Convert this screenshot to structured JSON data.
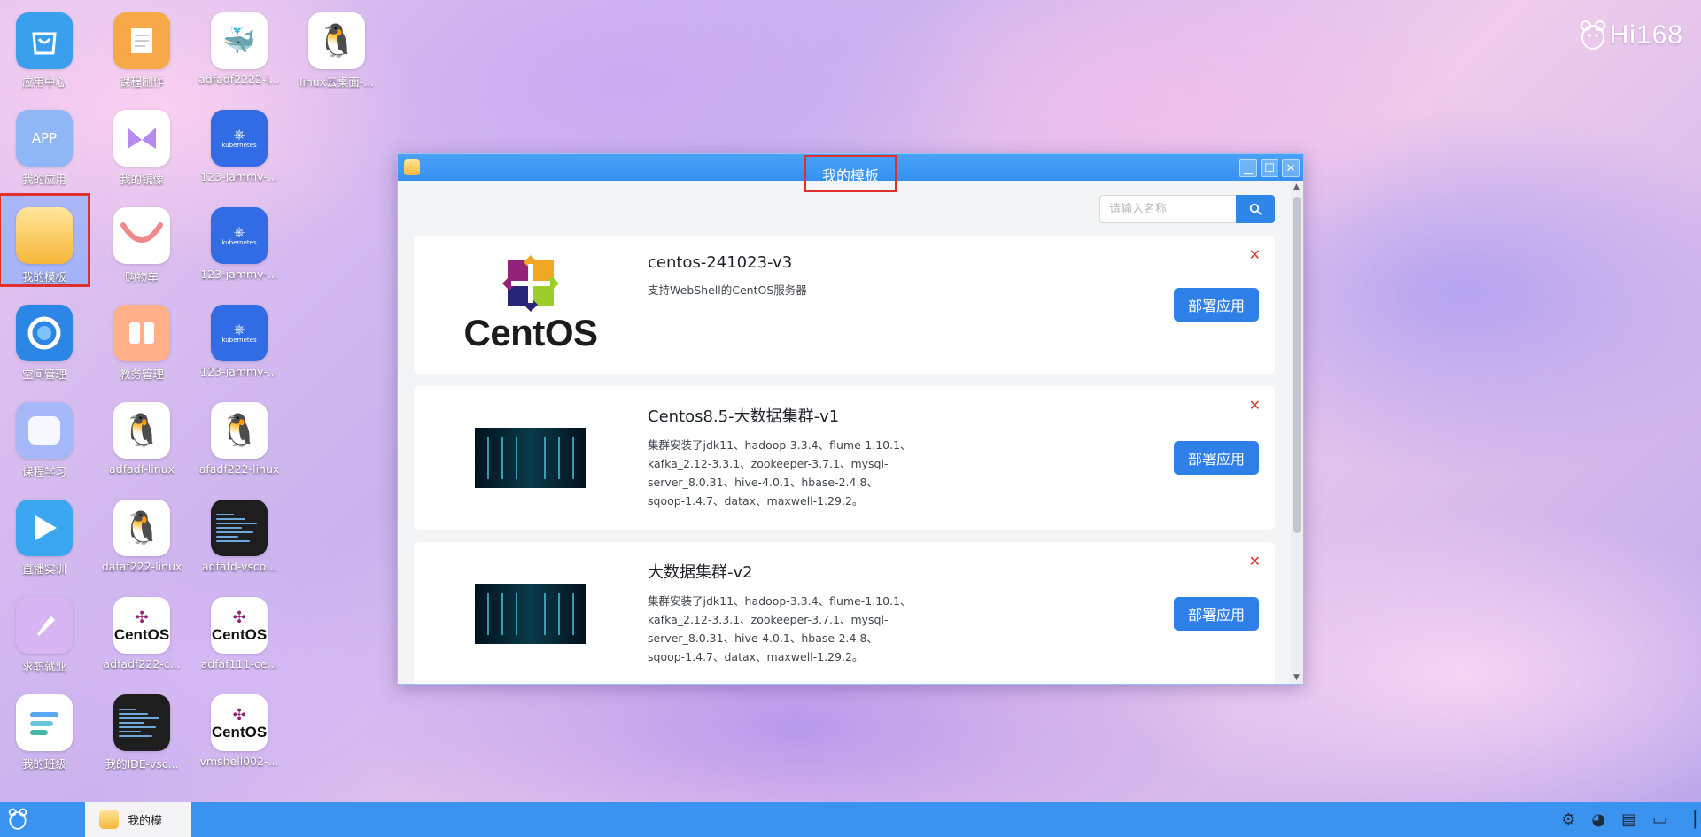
{
  "brand": {
    "text": "Hi168"
  },
  "desktop_icons": [
    {
      "label": "应用中心",
      "type": "app-center",
      "color": "#3aa0ee"
    },
    {
      "label": "课程制作",
      "type": "course-make",
      "color": "#f7a94a"
    },
    {
      "label": "adfadf2222-j...",
      "type": "docker",
      "color": "#ffffff"
    },
    {
      "label": "linux云桌面-...",
      "type": "linux",
      "color": "#ffffff"
    },
    {
      "label": "我的应用",
      "type": "my-apps",
      "icon_text": "APP",
      "color": "#8fb7f6"
    },
    {
      "label": "我的镜像",
      "type": "my-images",
      "color": "#ffffff"
    },
    {
      "label": "123-jammy-...",
      "type": "kubernetes",
      "icon_text": "kubernetes",
      "color": "#326ce5"
    },
    {
      "label": "我的模板",
      "type": "my-templates",
      "color": "#ffd27a"
    },
    {
      "label": "购物车",
      "type": "cart",
      "color": "#ffffff"
    },
    {
      "label": "123-jammy-...",
      "type": "kubernetes",
      "icon_text": "kubernetes",
      "color": "#326ce5"
    },
    {
      "label": "空间管理",
      "type": "space",
      "color": "#2c86e6"
    },
    {
      "label": "教务管理",
      "type": "academic",
      "color": "#ffb089"
    },
    {
      "label": "123-jammy-...",
      "type": "kubernetes",
      "icon_text": "kubernetes",
      "color": "#326ce5"
    },
    {
      "label": "课程学习",
      "type": "study",
      "color": "#a7b8f8"
    },
    {
      "label": "adfadf-linux",
      "type": "linux",
      "color": "#ffffff"
    },
    {
      "label": "afadf222-linux",
      "type": "linux",
      "color": "#ffffff"
    },
    {
      "label": "直播实训",
      "type": "live",
      "color": "#3aa7f0"
    },
    {
      "label": "dafaf222-linux",
      "type": "linux",
      "color": "#ffffff"
    },
    {
      "label": "adfafd-vsco...",
      "type": "vscode",
      "color": "#1e1e1e"
    },
    {
      "label": "求职就业",
      "type": "jobs",
      "color": "#d7b4f2"
    },
    {
      "label": "adfadf222-c...",
      "type": "centos",
      "icon_text": "CentOS",
      "color": "#ffffff"
    },
    {
      "label": "adfaf111-ce...",
      "type": "centos",
      "icon_text": "CentOS",
      "color": "#ffffff"
    },
    {
      "label": "我的班级",
      "type": "class",
      "color": "#ffffff"
    },
    {
      "label": "我的IDE-vsc...",
      "type": "vscode",
      "color": "#1e1e1e"
    },
    {
      "label": "vmshell002-...",
      "type": "centos",
      "icon_text": "CentOS",
      "color": "#ffffff"
    }
  ],
  "window": {
    "title": "我的模板",
    "search": {
      "placeholder": "请输入名称",
      "value": ""
    },
    "templates": [
      {
        "name": "centos-241023-v3",
        "description": "支持WebShell的CentOS服务器",
        "logo_text": "CentOS",
        "deploy_label": "部署应用"
      },
      {
        "name": "Centos8.5-大数据集群-v1",
        "description": "集群安装了jdk11、hadoop-3.3.4、flume-1.10.1、kafka_2.12-3.3.1、zookeeper-3.7.1、mysql-server_8.0.31、hive-4.0.1、hbase-2.4.8、sqoop-1.4.7、datax、maxwell-1.29.2。",
        "deploy_label": "部署应用"
      },
      {
        "name": "大数据集群-v2",
        "description": "集群安装了jdk11、hadoop-3.3.4、flume-1.10.1、kafka_2.12-3.3.1、zookeeper-3.7.1、mysql-server_8.0.31、hive-4.0.1、hbase-2.4.8、sqoop-1.4.7、datax、maxwell-1.29.2。",
        "deploy_label": "部署应用"
      }
    ]
  },
  "taskbar": {
    "items": [
      {
        "label": "我的模"
      }
    ],
    "tray_icons": [
      "settings-icon",
      "wechat-icon",
      "chat-icon",
      "monitor-icon",
      "show-desktop-icon"
    ]
  },
  "colors": {
    "accent": "#2f7fe8",
    "titlebar": "#3a93ee",
    "selection_outline": "#e0302e",
    "delete": "#e0302e"
  }
}
